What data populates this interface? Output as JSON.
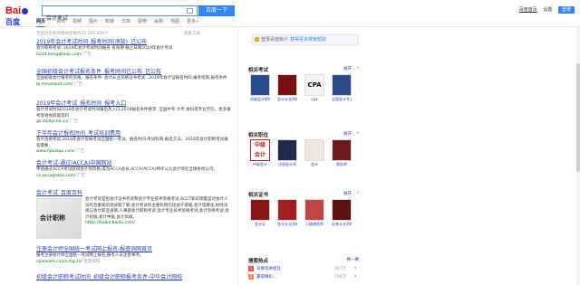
{
  "search": {
    "query": "会计考试",
    "button": "百度一下"
  },
  "toplinks": [
    "百度首页",
    "设置",
    "登录"
  ],
  "tabs": [
    "网页",
    "资讯",
    "视频",
    "图片",
    "知道",
    "文库",
    "贴吧",
    "采购",
    "地图",
    "更多»"
  ],
  "meta": "百度为您找到相关结果约35,300,000个",
  "tools": "搜索工具",
  "results": [
    {
      "title": "2019年会计考试时间_报考时间(须知)_已公布",
      "abstract": "会计职称考试: 2019年会计考试时间报名 有效期 截止日期2019年会计考试",
      "url": "b234.hengqiluop.com/",
      "extra": "广告"
    },
    {
      "title": "全国初级会计考试报名条件_报考时间已公布_已公布",
      "abstract": "全国初级会计报考的资格。报名条件: 会计从业资格证书考试...2019年会计证报名时间,报考指南,报考条件",
      "url": "bj.meunland.com/",
      "extra": "广告"
    },
    {
      "title": "2019年会计考试_报名时间_报考入口",
      "abstract": "会计考试时间2019年会计考试时间报名及入口,2019报名条件要求: 全国中专,大专,本科或专业学历。更多报考等待你获取资料",
      "url": "gz.studycnb.cn/",
      "extra": "广告"
    },
    {
      "title": "下半年会计报名时间_考试培训费用",
      "abstract": "会计资格考试,2019年会计资格考试全国统一考试。报名时间,考试科目,报名方法。2019年会计职称考试报名需要...",
      "url": "www.fqkuaqu.com/",
      "extra": "广告"
    },
    {
      "title": "会计考试-通过(ACCA)中国网站",
      "abstract": "申请通过ACCA考试获得会计师资格,成为ACCA会员,ACCA(ACCA)特许公认会计师在全球各地认可。",
      "url": "cn.accaglobal.com/",
      "extra": "广告"
    },
    {
      "title": "会计考试_百度百科",
      "abstract": "会计考试是指会计证书考试和会计专业技术资格考试,ACCT知识测量是对会计人员综合素质的测试和了解,会计考试的主要科目包括会计基础,会计电算化,财经法规与会计职业道德,人事部会计职称考试,会计专业技术资格考试,会计资格考试,会计初级,会计中级,会计高级。",
      "url": "https://baike.baidu.com/",
      "thumb": "会计职称"
    },
    {
      "title": "注册会计师全国统一考试网上报名-报查询网首页",
      "abstract": "报考注册会计师全国统一考试网上报名,报考人员注意事项。",
      "url": "cpaexam.cicpa.org.cn/",
      "extra": "百度快照"
    },
    {
      "title": "初级会计职称考试时间_初级会计职称报考条件-中华会计网校",
      "abstract": "",
      "url": "",
      "extra": ""
    }
  ],
  "right": {
    "banner": {
      "text": "登录百度账户",
      "link": "获得更多搜索帮助"
    },
    "sections": [
      {
        "title": "相关考试",
        "more": "展开",
        "cards": [
          {
            "caption": "初级会计职称考试",
            "color": "#2b4a8a"
          },
          {
            "caption": "会计从业资格考试",
            "color": "#7a0f12"
          },
          {
            "caption": "cpa",
            "color": "#f4f4f4"
          },
          {
            "caption": "全国会计专业技术资格考试",
            "color": "#2b4a8a"
          }
        ]
      },
      {
        "title": "相关职位",
        "more": "展开",
        "cards": [
          {
            "caption": "中级会计",
            "color": "#b52020"
          },
          {
            "caption": "注册会计师",
            "color": "#1d2a4a"
          },
          {
            "caption": "会计",
            "color": "#f0e8e0"
          },
          {
            "caption": "税务师",
            "color": "#6e1a1a"
          }
        ]
      },
      {
        "title": "相关证书",
        "more": "展开",
        "cards": [
          {
            "caption": "会计证",
            "color": "#8a1515"
          },
          {
            "caption": "会计从业资格证书",
            "color": "#a02020"
          },
          {
            "caption": "二级建造师",
            "color": "#c24545"
          },
          {
            "caption": "证券从业资格证",
            "color": "#5a1212"
          }
        ]
      }
    ],
    "hot": {
      "title": "搜索热点",
      "refresh": "换一换",
      "items": [
        {
          "num": "1",
          "text": "刘德华将担任",
          "count": "987万",
          "color": "#f54545"
        },
        {
          "num": "2",
          "text": "赢得精彩…",
          "count": "706万",
          "color": "#ff8547"
        }
      ]
    }
  }
}
